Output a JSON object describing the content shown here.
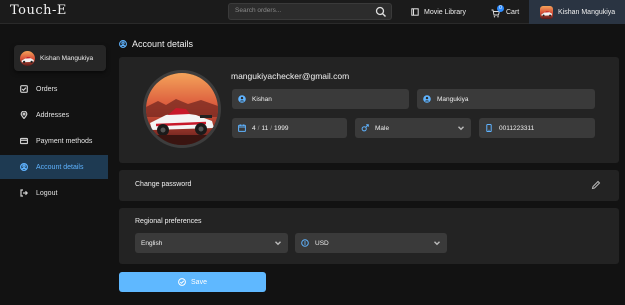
{
  "header": {
    "logo": "Touch-E",
    "search_placeholder": "Search orders...",
    "movie_library_label": "Movie Library",
    "cart_label": "Cart",
    "cart_count": "0",
    "user_name": "Kishan Mangukiya"
  },
  "sidebar": {
    "profile_name": "Kishan Mangukiya",
    "items": [
      {
        "label": "Orders",
        "icon": "orders-icon",
        "active": false
      },
      {
        "label": "Addresses",
        "icon": "location-pin-icon",
        "active": false
      },
      {
        "label": "Payment methods",
        "icon": "credit-card-icon",
        "active": false
      },
      {
        "label": "Account details",
        "icon": "user-circle-icon",
        "active": true
      },
      {
        "label": "Logout",
        "icon": "logout-icon",
        "active": false
      }
    ]
  },
  "account": {
    "heading": "Account details",
    "email": "mangukiyachecker@gmail.com",
    "first_name": "Kishan",
    "last_name": "Mangukiya",
    "dob": {
      "day": "4",
      "month": "11",
      "year": "1999"
    },
    "gender": "Male",
    "phone": "0011223311"
  },
  "password": {
    "label": "Change password"
  },
  "regional": {
    "label": "Regional preferences",
    "language": "English",
    "currency": "USD"
  },
  "save_label": "Save",
  "colors": {
    "accent": "#5fb8ff",
    "active_bg": "#1e3a52",
    "panel_bg": "#232323",
    "field_bg": "#3a3a3a"
  }
}
